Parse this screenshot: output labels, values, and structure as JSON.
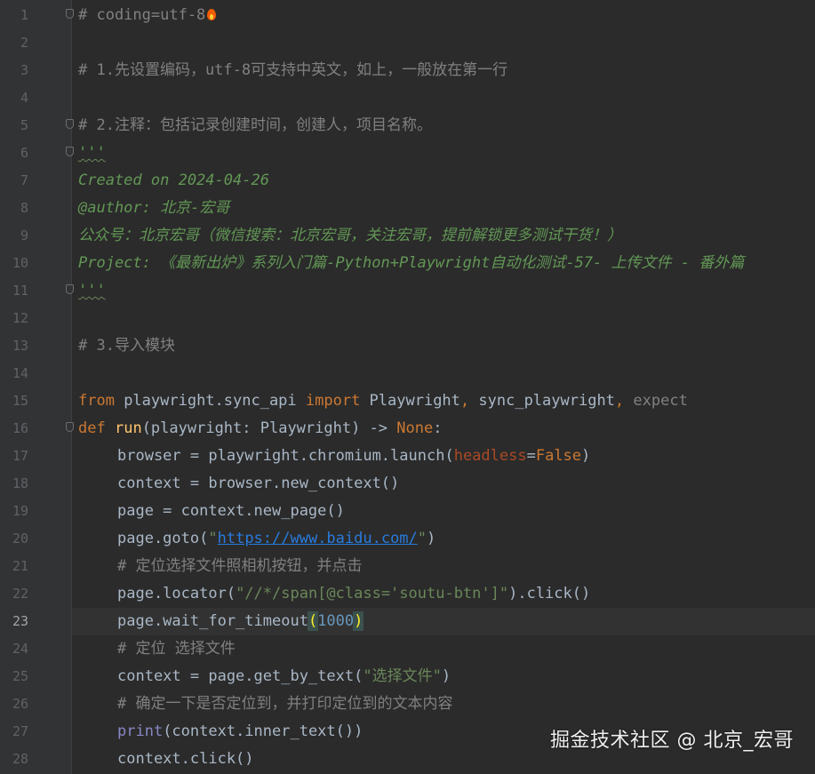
{
  "editor": {
    "current_line": 23,
    "lines": [
      {
        "n": "1",
        "parts": [
          [
            "cm",
            "# coding=utf-8"
          ]
        ]
      },
      {
        "n": "2",
        "parts": []
      },
      {
        "n": "3",
        "parts": [
          [
            "cm",
            "# 1.先设置编码，utf-8可支持中英文，如上，一般放在第一行"
          ]
        ]
      },
      {
        "n": "4",
        "parts": []
      },
      {
        "n": "5",
        "parts": [
          [
            "cm",
            "# 2.注释：包括记录创建时间，创建人，项目名称。"
          ]
        ]
      },
      {
        "n": "6",
        "parts": [
          [
            "doc",
            "'''"
          ]
        ]
      },
      {
        "n": "7",
        "parts": [
          [
            "doc",
            "Created on 2024-04-26"
          ]
        ]
      },
      {
        "n": "8",
        "parts": [
          [
            "doc",
            "@author: 北京-宏哥"
          ]
        ]
      },
      {
        "n": "9",
        "parts": [
          [
            "doc",
            "公众号：北京宏哥（微信搜索：北京宏哥，关注宏哥，提前解锁更多测试干货！）"
          ]
        ]
      },
      {
        "n": "10",
        "parts": [
          [
            "doc",
            "Project: 《最新出炉》系列入门篇-Python+Playwright自动化测试-57- 上传文件 - 番外篇"
          ]
        ]
      },
      {
        "n": "11",
        "parts": [
          [
            "doc",
            "'''"
          ]
        ]
      },
      {
        "n": "12",
        "parts": []
      },
      {
        "n": "13",
        "parts": [
          [
            "cm",
            "# 3.导入模块"
          ]
        ]
      },
      {
        "n": "14",
        "parts": []
      },
      {
        "n": "15",
        "parts": [
          [
            "kw",
            "from"
          ],
          [
            "txt",
            " playwright.sync_api "
          ],
          [
            "kw",
            "import"
          ],
          [
            "txt",
            " Playwright"
          ],
          [
            "kw",
            ","
          ],
          [
            "txt",
            " sync_playwright"
          ],
          [
            "kw",
            ","
          ],
          [
            "dim",
            " expect"
          ]
        ]
      },
      {
        "n": "16",
        "parts": [
          [
            "kw",
            "def"
          ],
          [
            "txt",
            " "
          ],
          [
            "fn",
            "run"
          ],
          [
            "txt",
            "(playwright: Playwright) -> "
          ],
          [
            "kw",
            "None"
          ],
          [
            "txt",
            ":"
          ]
        ]
      },
      {
        "n": "17",
        "parts": [
          [
            "txt",
            "browser = playwright.chromium.launch("
          ],
          [
            "par",
            "headless"
          ],
          [
            "txt",
            "="
          ],
          [
            "kw",
            "False"
          ],
          [
            "txt",
            ")"
          ]
        ]
      },
      {
        "n": "18",
        "parts": [
          [
            "txt",
            "context = browser.new_context()"
          ]
        ]
      },
      {
        "n": "19",
        "parts": [
          [
            "txt",
            "page = context.new_page()"
          ]
        ]
      },
      {
        "n": "20",
        "parts": [
          [
            "txt",
            "page.goto("
          ],
          [
            "str",
            "\""
          ],
          [
            "link",
            "https://www.baidu.com/"
          ],
          [
            "str",
            "\""
          ],
          [
            "txt",
            ")"
          ]
        ]
      },
      {
        "n": "21",
        "parts": [
          [
            "cm",
            "# 定位选择文件照相机按钮，并点击"
          ]
        ]
      },
      {
        "n": "22",
        "parts": [
          [
            "txt",
            "page.locator("
          ],
          [
            "str",
            "\"//*/span[@class='soutu-btn']\""
          ],
          [
            "txt",
            ").click()"
          ]
        ]
      },
      {
        "n": "23",
        "parts": [
          [
            "txt",
            "page.wait_for_timeout"
          ],
          [
            "brace",
            "("
          ],
          [
            "num",
            "1000"
          ],
          [
            "brace",
            ")"
          ]
        ]
      },
      {
        "n": "24",
        "parts": [
          [
            "cm",
            "# 定位 选择文件"
          ]
        ]
      },
      {
        "n": "25",
        "parts": [
          [
            "txt",
            "context = page.get_by_text("
          ],
          [
            "str",
            "\"选择文件\""
          ],
          [
            "txt",
            ")"
          ]
        ]
      },
      {
        "n": "26",
        "parts": [
          [
            "cm",
            "# 确定一下是否定位到，并打印定位到的文本内容"
          ]
        ]
      },
      {
        "n": "27",
        "parts": [
          [
            "kw2",
            "print"
          ],
          [
            "txt",
            "(context.inner_text())"
          ]
        ]
      },
      {
        "n": "28",
        "parts": [
          [
            "txt",
            "context.click()"
          ]
        ]
      }
    ]
  },
  "watermark": "掘金技术社区 @ 北京_宏哥",
  "colors": {
    "background": "#2b2b2b",
    "gutter": "#313335",
    "comment": "#808080",
    "docstring": "#629755",
    "keyword": "#cc7832",
    "function": "#ffc66d",
    "string": "#6a8759",
    "number": "#6897bb"
  }
}
